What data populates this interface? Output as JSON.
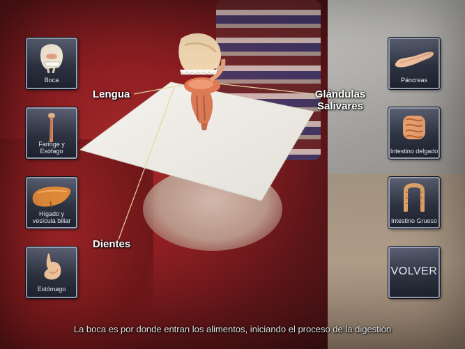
{
  "ar_labels": {
    "lengua": "Lengua",
    "glandulas": "Glándulas Salivares",
    "dientes": "Dientes"
  },
  "left_buttons": [
    {
      "label": "Boca",
      "icon": "mouth-anatomy-icon"
    },
    {
      "label": "Faringe y Esófago",
      "icon": "esophagus-icon"
    },
    {
      "label": "Hígado y vesícula biliar",
      "icon": "liver-icon"
    },
    {
      "label": "Estómago",
      "icon": "stomach-icon"
    }
  ],
  "right_buttons": [
    {
      "label": "Páncreas",
      "icon": "pancreas-icon"
    },
    {
      "label": "Intestino delgado",
      "icon": "small-intestine-icon"
    },
    {
      "label": "Intestino Grueso",
      "icon": "large-intestine-icon"
    }
  ],
  "volver_label": "VOLVER",
  "caption": "La boca es por donde entran los alimentos, iniciando el proceso de la digestión",
  "colors": {
    "button_border": "#9aa3b5",
    "button_fill": "#2f3443",
    "label_text": "#ffffff",
    "marker_card": "#f2efe9"
  }
}
